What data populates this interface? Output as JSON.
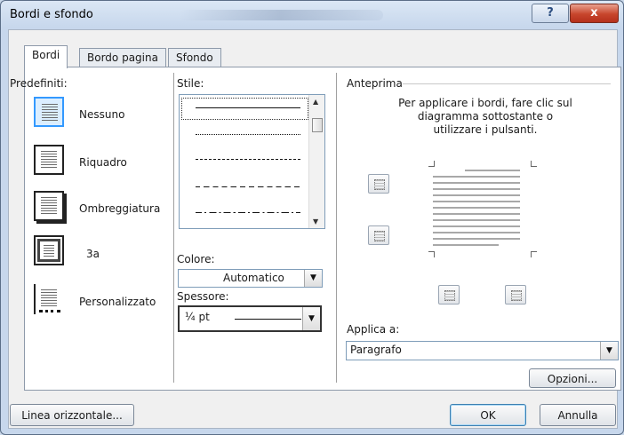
{
  "window": {
    "title": "Bordi e sfondo"
  },
  "titlebar": {
    "help_label": "?",
    "close_label": "x"
  },
  "tabs": [
    {
      "label": "Bordi"
    },
    {
      "label": "Bordo pagina"
    },
    {
      "label": "Sfondo"
    }
  ],
  "presets": {
    "heading": "Predefiniti:",
    "items": [
      {
        "label": "Nessuno"
      },
      {
        "label": "Riquadro"
      },
      {
        "label": "Ombreggiatura"
      },
      {
        "label": "3a"
      },
      {
        "label": "Personalizzato"
      }
    ]
  },
  "style": {
    "heading": "Stile:"
  },
  "color": {
    "label": "Colore:",
    "value": "Automatico"
  },
  "width": {
    "label": "Spessore:",
    "value": "¼ pt"
  },
  "preview": {
    "heading": "Anteprima",
    "instructions": [
      "Per applicare i bordi, fare clic sul",
      "diagramma sottostante o",
      "utilizzare i pulsanti."
    ]
  },
  "apply_to": {
    "label": "Applica a:",
    "value": "Paragrafo"
  },
  "buttons": {
    "options": "Opzioni...",
    "horizontal_line": "Linea orizzontale...",
    "ok": "OK",
    "cancel": "Annulla"
  },
  "colors": {
    "selection": "#3399ff",
    "close_button": "#c7452c"
  }
}
